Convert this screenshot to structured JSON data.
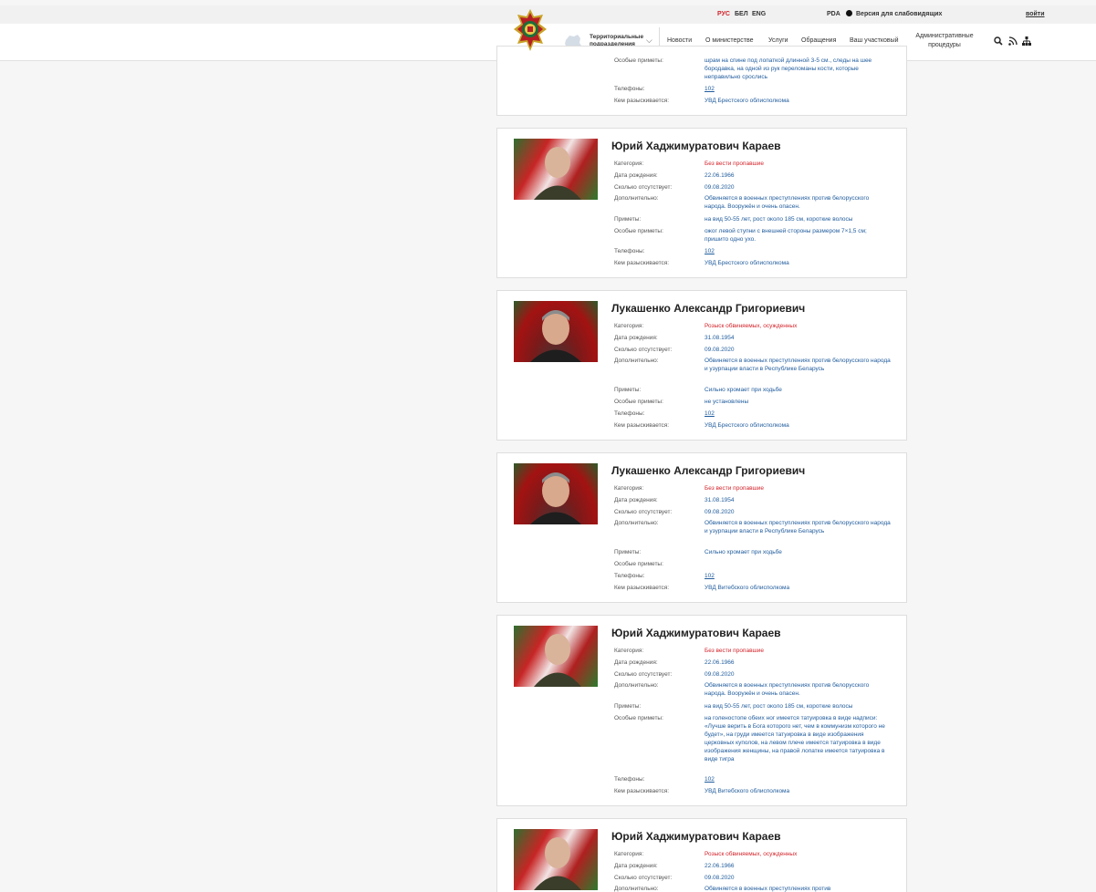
{
  "header": {
    "lang": [
      "РУС",
      "БЕЛ",
      "ENG"
    ],
    "pda": "PDA",
    "low_vision": "Версия для слабовидящих",
    "login": "войти",
    "territorial": [
      "Территориальные",
      "подразделения"
    ],
    "nav": [
      "Новости",
      "О министерстве",
      "Услуги",
      "Обращения",
      "Ваш участковый"
    ],
    "admin": "Административные процедуры"
  },
  "partial_card": {
    "features_label": "Особые приметы:",
    "features_value": "шрам на спине под лопаткой длинной 3-5 см., следы на шее бородавка, на одной из рук переломаны кости, которые неправильно срослись",
    "phones_label": "Телефоны:",
    "phones_value": "102",
    "wanted_label": "Кем разыскивается:",
    "wanted_value": "УВД Брестского облисполкома"
  },
  "labels": {
    "category": "Категория:",
    "birth": "Дата рождения:",
    "missing": "Сколько отсутствует:",
    "extra": "Дополнительно:",
    "signs": "Приметы:",
    "features": "Особые приметы:",
    "phones": "Телефоны:",
    "wanted": "Кем разыскивается:"
  },
  "cards": [
    {
      "name": "Юрий Хаджимуратович Караев",
      "category": "Без вести пропавшие",
      "birth": "22.06.1966",
      "missing": "09.08.2020",
      "extra": "Обвиняется в военных преступлениях против белорусского народа. Вооружён и очень опасен.",
      "signs": "на вид 50-55 лет, рост около 185 см, короткие волосы",
      "features": "ожог левой ступни с внешней стороны размером 7×1,5 см; пришито одно ухо.",
      "phones": "102",
      "wanted": "УВД Брестского облисполкома"
    },
    {
      "name": "Лукашенко Александр Григориевич",
      "category": "Розыск обвиняемых, осужденных",
      "birth": "31.08.1954",
      "missing": "09.08.2020",
      "extra": "Обвиняется в военных преступлениях против белорусского народа и узурпации власти в Республике Беларусь",
      "signs": "Сильно хромает при ходьбе",
      "features": "не установлены",
      "phones": "102",
      "wanted": "УВД Брестского облисполкома"
    },
    {
      "name": "Лукашенко Александр Григориевич",
      "category": "Без вести пропавшие",
      "birth": "31.08.1954",
      "missing": "09.08.2020",
      "extra": "Обвиняется в военных преступлениях против белорусского народа и узурпации власти в Республике Беларусь",
      "signs": "Сильно хромает при ходьбе",
      "features": "",
      "phones": "102",
      "wanted": "УВД Витебского облисполкома"
    },
    {
      "name": "Юрий Хаджимуратович Караев",
      "category": "Без вести пропавшие",
      "birth": "22.06.1966",
      "missing": "09.08.2020",
      "extra": "Обвиняется в военных преступлениях против белорусского народа. Вооружён и очень опасен.",
      "signs": "на вид 50-55 лет, рост около 185 см, короткие волосы",
      "features": "на голеностопе обеих ног имеется татуировка в виде надписи: «Лучше верить в Бога которого нет, чем в коммунизм которого не будет», на груди имеется татуировка в виде изображения церковных куполов, на левом плече имеется татуировка в виде изображения женщины, на правой лопатке имеется татуировка в виде тигра",
      "phones": "102",
      "wanted": "УВД Витебского облисполкома"
    },
    {
      "name": "Юрий Хаджимуратович Караев",
      "category": "Розыск обвиняемых, осужденных",
      "birth": "22.06.1966",
      "missing": "09.08.2020",
      "extra": "Обвиняется в военных преступлениях против"
    }
  ],
  "colors": {
    "accent_red": "#d3242b",
    "link_blue": "#1f5b9c"
  }
}
